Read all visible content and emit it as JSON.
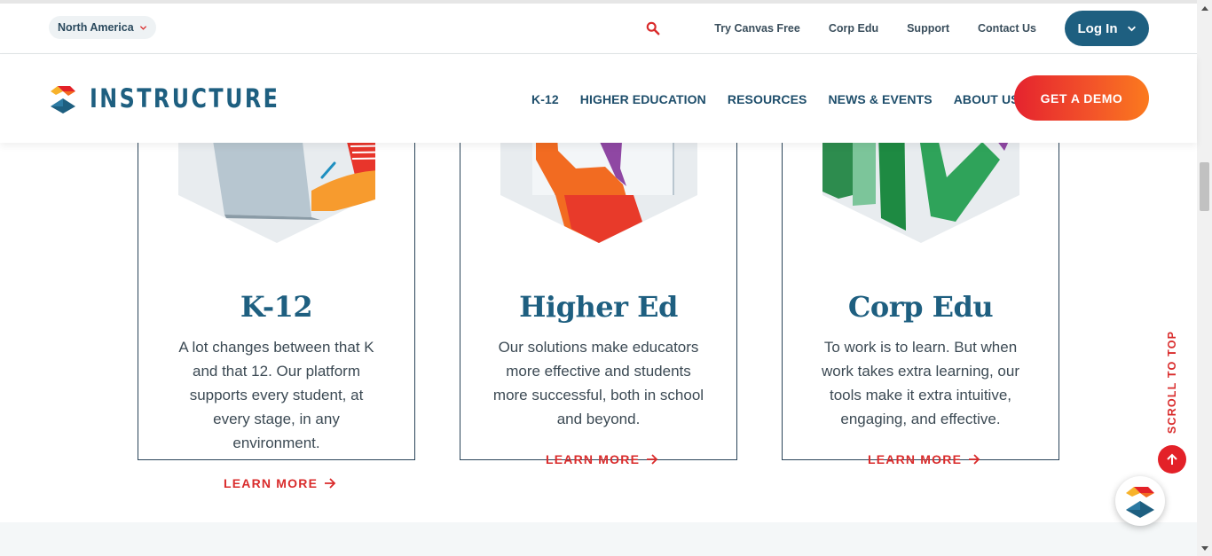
{
  "colors": {
    "brand_blue": "#1e5f80",
    "accent_red": "#d92b2b",
    "demo_gradient_start": "#e5232e",
    "demo_gradient_end": "#fb7a1e"
  },
  "utility_bar": {
    "region": "North America",
    "search_icon": "search-icon",
    "links": [
      "Try Canvas Free",
      "Corp Edu",
      "Support",
      "Contact Us"
    ],
    "login_label": "Log In"
  },
  "main_nav": {
    "logo_text": "INSTRUCTURE",
    "links": [
      "K-12",
      "HIGHER EDUCATION",
      "RESOURCES",
      "NEWS & EVENTS",
      "ABOUT US"
    ],
    "demo_label": "GET A DEMO"
  },
  "cards": [
    {
      "title": "K-12",
      "description": "A lot changes between that K and that 12. Our platform supports every student, at every stage, in any environment.",
      "link_label": "LEARN MORE"
    },
    {
      "title": "Higher Ed",
      "description": "Our solutions make educators more effective and students more successful, both in school and beyond.",
      "link_label": "LEARN MORE"
    },
    {
      "title": "Corp Edu",
      "description": "To work is to learn. But when work takes extra learning, our tools make it extra intuitive, engaging, and effective.",
      "link_label": "LEARN MORE"
    }
  ],
  "scroll_to_top": {
    "label": "SCROLL TO TOP"
  }
}
